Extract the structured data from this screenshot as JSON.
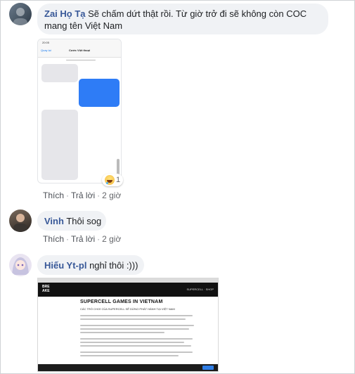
{
  "comments": [
    {
      "author": "Zai Họ Tạ",
      "text_line1": "Sẽ chấm dứt thật rồi. Từ giờ trở đi sẽ không còn COC",
      "text_line2": "mang tên Việt Nam",
      "attachment": {
        "status_time": "20:05",
        "back_label": "Quay lại",
        "title": "Cước Việt thoại"
      },
      "reaction": {
        "icon": "haha-emoji-icon",
        "count": "1"
      },
      "actions": {
        "like": "Thích",
        "reply": "Trả lời",
        "time": "2 giờ"
      }
    },
    {
      "author": "Vinh",
      "text": "Thôi sog",
      "actions": {
        "like": "Thích",
        "reply": "Trả lời",
        "time": "2 giờ"
      }
    },
    {
      "author": "Hiếu Yt-pl",
      "text": "nghỉ thôi :)))",
      "attachment": {
        "logo": "BRE AKE",
        "nav_right": "SUPERCELL · SHOP",
        "headline": "SUPERCELL GAMES IN VIETNAM",
        "subheadline": "CÁC TRÒ CHƠI CỦA SUPERCELL SẼ DỪNG PHÁT HÀNH TẠI VIỆT NAM"
      }
    }
  ],
  "colors": {
    "author": "#385898",
    "bubble": "#f0f2f5",
    "link_gray": "#4b4f56"
  }
}
